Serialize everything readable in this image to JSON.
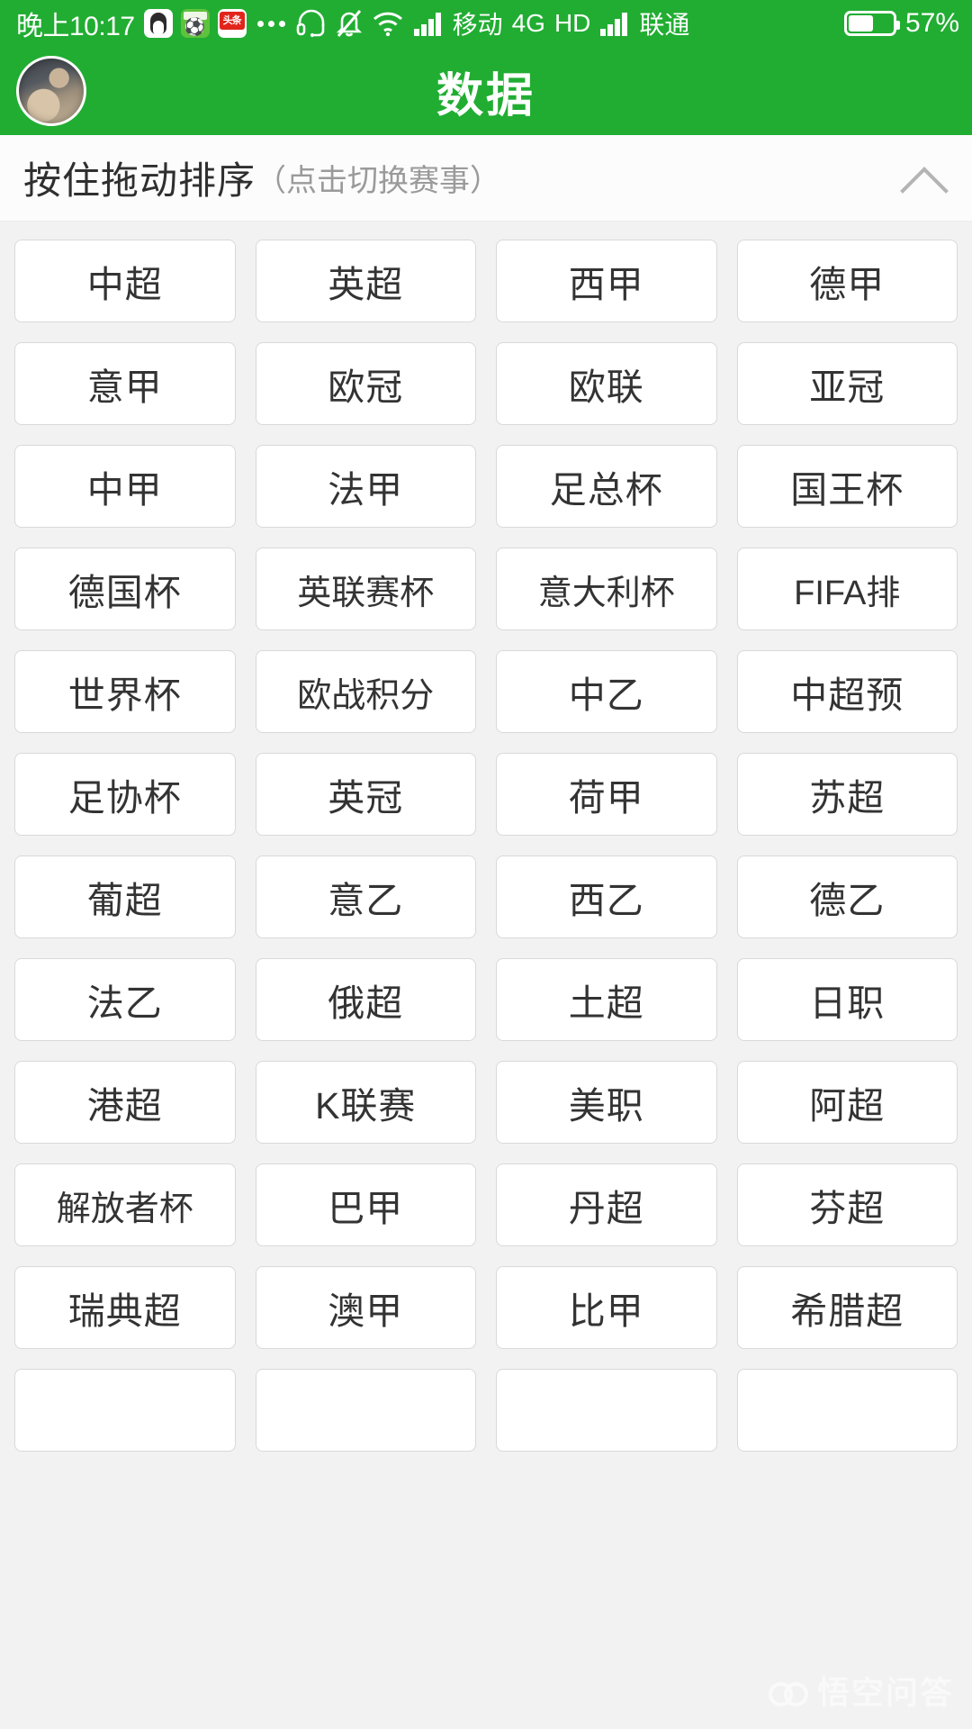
{
  "status_bar": {
    "time": "晚上10:17",
    "app_icons": [
      "qq-icon",
      "football-app-icon",
      "toutiao-icon"
    ],
    "overflow": "...",
    "icons": [
      "headset-icon",
      "bell-muted-icon",
      "wifi-icon",
      "signal-icon"
    ],
    "carrier_primary": "移动",
    "network_type": "4G",
    "hd_label": "HD",
    "carrier_secondary": "联通",
    "battery_percent": "57%",
    "battery_level": 57
  },
  "title_bar": {
    "title": "数据",
    "avatar": "user-avatar"
  },
  "sort_header": {
    "main_text": "按住拖动排序",
    "sub_text": "（点击切换赛事）",
    "collapse_icon": "chevron-up-icon"
  },
  "leagues": [
    "中超",
    "英超",
    "西甲",
    "德甲",
    "意甲",
    "欧冠",
    "欧联",
    "亚冠",
    "中甲",
    "法甲",
    "足总杯",
    "国王杯",
    "德国杯",
    "英联赛杯",
    "意大利杯",
    "FIFA排",
    "世界杯",
    "欧战积分",
    "中乙",
    "中超预",
    "足协杯",
    "英冠",
    "荷甲",
    "苏超",
    "葡超",
    "意乙",
    "西乙",
    "德乙",
    "法乙",
    "俄超",
    "土超",
    "日职",
    "港超",
    "K联赛",
    "美职",
    "阿超",
    "解放者杯",
    "巴甲",
    "丹超",
    "芬超",
    "瑞典超",
    "澳甲",
    "比甲",
    "希腊超",
    "",
    "",
    "",
    ""
  ],
  "watermark": {
    "text": "悟空问答",
    "mark": "wukong-logo"
  },
  "colors": {
    "brand_green": "#21ad32",
    "page_background": "#f2f2f2",
    "cell_background": "#ffffff",
    "cell_border": "#d9d9d9",
    "text_primary": "#333333",
    "text_muted": "#9a9a9a"
  }
}
